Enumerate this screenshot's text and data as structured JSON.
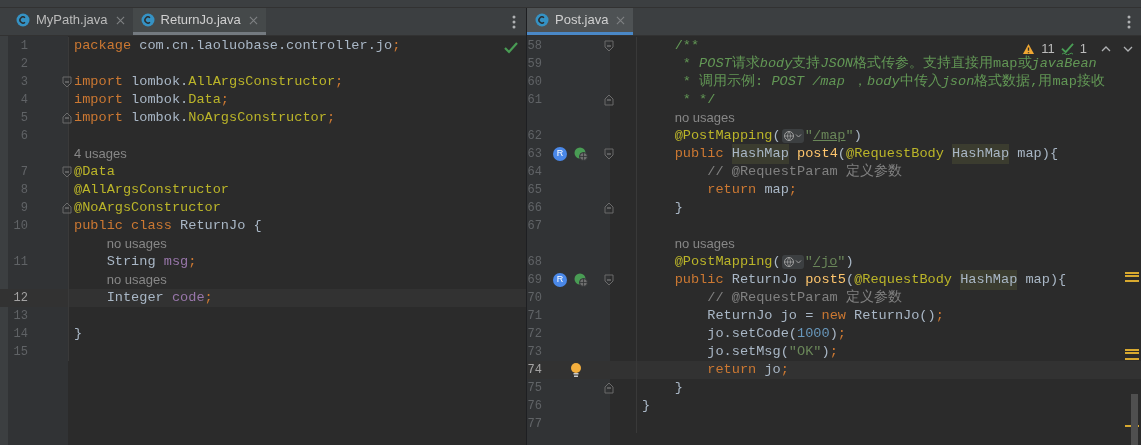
{
  "panes": [
    {
      "focused": false,
      "inspection": {
        "kind": "ok"
      },
      "tabs": [
        {
          "label": "MyPath.java",
          "selected": false
        },
        {
          "label": "ReturnJo.java",
          "selected": true
        }
      ],
      "lines": [
        {
          "num": "1",
          "current": false,
          "fold_open": false,
          "fold_close": false,
          "tokens": [
            {
              "kind": "kw",
              "text": "package "
            },
            {
              "kind": "plain",
              "text": "com.cn.laoluobase.controller.jo"
            },
            {
              "kind": "kw",
              "text": ";"
            }
          ]
        },
        {
          "num": "2",
          "current": false,
          "fold_open": false,
          "fold_close": false
        },
        {
          "num": "3",
          "current": false,
          "fold_open": true,
          "fold_close": false,
          "tokens": [
            {
              "kind": "kw",
              "text": "import "
            },
            {
              "kind": "plain",
              "text": "lombok."
            },
            {
              "kind": "ann",
              "text": "AllArgsConstructor"
            },
            {
              "kind": "kw",
              "text": ";"
            }
          ]
        },
        {
          "num": "4",
          "current": false,
          "fold_open": false,
          "fold_close": false,
          "tokens": [
            {
              "kind": "kw",
              "text": "import "
            },
            {
              "kind": "plain",
              "text": "lombok."
            },
            {
              "kind": "ann",
              "text": "Data"
            },
            {
              "kind": "kw",
              "text": ";"
            }
          ]
        },
        {
          "num": "5",
          "current": false,
          "fold_open": false,
          "fold_close": true,
          "tokens": [
            {
              "kind": "kw",
              "text": "import "
            },
            {
              "kind": "plain",
              "text": "lombok."
            },
            {
              "kind": "ann",
              "text": "NoArgsConstructor"
            },
            {
              "kind": "kw",
              "text": ";"
            }
          ]
        },
        {
          "num": "6",
          "current": false,
          "fold_open": false,
          "fold_close": false
        },
        {
          "hint": "4 usages"
        },
        {
          "num": "7",
          "current": false,
          "fold_open": true,
          "fold_close": false,
          "tokens": [
            {
              "kind": "ann",
              "text": "@Data"
            }
          ]
        },
        {
          "num": "8",
          "current": false,
          "fold_open": false,
          "fold_close": false,
          "tokens": [
            {
              "kind": "ann",
              "text": "@AllArgsConstructor"
            }
          ]
        },
        {
          "num": "9",
          "current": false,
          "fold_open": false,
          "fold_close": true,
          "tokens": [
            {
              "kind": "ann",
              "text": "@NoArgsConstructor"
            }
          ]
        },
        {
          "num": "10",
          "current": false,
          "fold_open": false,
          "fold_close": false,
          "tokens": [
            {
              "kind": "kw",
              "text": "public class "
            },
            {
              "kind": "plain",
              "text": "ReturnJo {"
            }
          ]
        },
        {
          "hint": "no usages"
        },
        {
          "num": "11",
          "current": false,
          "fold_open": false,
          "fold_close": false,
          "tokens": [
            {
              "kind": "plain",
              "text": "    String "
            },
            {
              "kind": "fld",
              "text": "msg"
            },
            {
              "kind": "kw",
              "text": ";"
            }
          ]
        },
        {
          "hint": "no usages"
        },
        {
          "num": "12",
          "current": true,
          "fold_open": false,
          "fold_close": false,
          "tokens": [
            {
              "kind": "plain",
              "text": "    Integer "
            },
            {
              "kind": "fld",
              "text": "code"
            },
            {
              "kind": "kw",
              "text": ";"
            }
          ]
        },
        {
          "num": "13",
          "current": false,
          "fold_open": false,
          "fold_close": false
        },
        {
          "num": "14",
          "current": false,
          "fold_open": false,
          "fold_close": false,
          "tokens": [
            {
              "kind": "plain",
              "text": "}"
            }
          ]
        },
        {
          "num": "15",
          "current": false,
          "fold_open": false,
          "fold_close": false
        }
      ]
    },
    {
      "focused": true,
      "inspection": {
        "kind": "problems",
        "warnings": "11",
        "typos": "1"
      },
      "tabs": [
        {
          "label": "Post.java",
          "selected": true
        }
      ],
      "lines": [
        {
          "num": "58",
          "current": false,
          "fold_open": true,
          "fold_close": false,
          "endpoint": false,
          "bulb": false,
          "tokens": [
            {
              "kind": "doc",
              "text": "    /**"
            }
          ]
        },
        {
          "num": "59",
          "current": false,
          "fold_open": false,
          "fold_close": false,
          "endpoint": false,
          "bulb": false,
          "tokens": [
            {
              "kind": "doc",
              "text": "     * "
            },
            {
              "kind": "doci",
              "text": "POST"
            },
            {
              "kind": "doc",
              "text": "请求"
            },
            {
              "kind": "doci",
              "text": "body"
            },
            {
              "kind": "doc",
              "text": "支持"
            },
            {
              "kind": "doci",
              "text": "JSON"
            },
            {
              "kind": "doc",
              "text": "格式传参。支持直接用map或"
            },
            {
              "kind": "doci",
              "text": "javaBean"
            }
          ]
        },
        {
          "num": "60",
          "current": false,
          "fold_open": false,
          "fold_close": false,
          "endpoint": false,
          "bulb": false,
          "tokens": [
            {
              "kind": "doc",
              "text": "     * 调用示例: "
            },
            {
              "kind": "doci",
              "text": "POST /map"
            },
            {
              "kind": "doc",
              "text": " ，"
            },
            {
              "kind": "doci",
              "text": "body"
            },
            {
              "kind": "doc",
              "text": "中传入"
            },
            {
              "kind": "doci",
              "text": "json"
            },
            {
              "kind": "doc",
              "text": "格式数据,用map接收"
            }
          ]
        },
        {
          "num": "61",
          "current": false,
          "fold_open": false,
          "fold_close": true,
          "endpoint": false,
          "bulb": false,
          "tokens": [
            {
              "kind": "doc",
              "text": "     * */"
            }
          ]
        },
        {
          "hint": "no usages"
        },
        {
          "num": "62",
          "current": false,
          "fold_open": false,
          "fold_close": false,
          "endpoint": false,
          "bulb": false,
          "tokens": [
            {
              "kind": "ann",
              "text": "    @PostMapping"
            },
            {
              "kind": "plain",
              "text": "("
            },
            {
              "kind": "globe"
            },
            {
              "kind": "str",
              "text": "\""
            },
            {
              "kind": "url",
              "text": "/map"
            },
            {
              "kind": "str",
              "text": "\""
            },
            {
              "kind": "plain",
              "text": ")"
            }
          ]
        },
        {
          "num": "63",
          "current": false,
          "fold_open": true,
          "fold_close": false,
          "badge": "R",
          "endpoint": true,
          "bulb": false,
          "tokens": [
            {
              "kind": "kw",
              "text": "    public "
            },
            {
              "kind": "hl",
              "text": "HashMap"
            },
            {
              "kind": "method",
              "text": " post4"
            },
            {
              "kind": "plain",
              "text": "("
            },
            {
              "kind": "ann",
              "text": "@RequestBody "
            },
            {
              "kind": "hl",
              "text": "HashMap"
            },
            {
              "kind": "plain",
              "text": " map){"
            }
          ]
        },
        {
          "num": "64",
          "current": false,
          "fold_open": false,
          "fold_close": false,
          "endpoint": false,
          "bulb": false,
          "tokens": [
            {
              "kind": "comment",
              "text": "        // @RequestParam 定义参数"
            }
          ]
        },
        {
          "num": "65",
          "current": false,
          "fold_open": false,
          "fold_close": false,
          "endpoint": false,
          "bulb": false,
          "tokens": [
            {
              "kind": "kw",
              "text": "        return "
            },
            {
              "kind": "plain",
              "text": "map"
            },
            {
              "kind": "kw",
              "text": ";"
            }
          ]
        },
        {
          "num": "66",
          "current": false,
          "fold_open": false,
          "fold_close": true,
          "endpoint": false,
          "bulb": false,
          "tokens": [
            {
              "kind": "plain",
              "text": "    }"
            }
          ]
        },
        {
          "num": "67",
          "current": false,
          "fold_open": false,
          "fold_close": false,
          "endpoint": false,
          "bulb": false
        },
        {
          "hint": "no usages"
        },
        {
          "num": "68",
          "current": false,
          "fold_open": false,
          "fold_close": false,
          "endpoint": false,
          "bulb": false,
          "tokens": [
            {
              "kind": "ann",
              "text": "    @PostMapping"
            },
            {
              "kind": "plain",
              "text": "("
            },
            {
              "kind": "globe"
            },
            {
              "kind": "str",
              "text": "\""
            },
            {
              "kind": "url",
              "text": "/jo"
            },
            {
              "kind": "str",
              "text": "\""
            },
            {
              "kind": "plain",
              "text": ")"
            }
          ]
        },
        {
          "num": "69",
          "current": false,
          "fold_open": true,
          "fold_close": false,
          "badge": "R",
          "endpoint": true,
          "bulb": false,
          "tokens": [
            {
              "kind": "kw",
              "text": "    public "
            },
            {
              "kind": "plain",
              "text": "ReturnJo"
            },
            {
              "kind": "method",
              "text": " post5"
            },
            {
              "kind": "plain",
              "text": "("
            },
            {
              "kind": "ann",
              "text": "@RequestBody "
            },
            {
              "kind": "hl",
              "text": "HashMap"
            },
            {
              "kind": "plain",
              "text": " map){"
            }
          ]
        },
        {
          "num": "70",
          "current": false,
          "fold_open": false,
          "fold_close": false,
          "endpoint": false,
          "bulb": false,
          "tokens": [
            {
              "kind": "comment",
              "text": "        // @RequestParam 定义参数"
            }
          ]
        },
        {
          "num": "71",
          "current": false,
          "fold_open": false,
          "fold_close": false,
          "endpoint": false,
          "bulb": false,
          "tokens": [
            {
              "kind": "plain",
              "text": "        ReturnJo jo = "
            },
            {
              "kind": "kw",
              "text": "new "
            },
            {
              "kind": "plain",
              "text": "ReturnJo()"
            },
            {
              "kind": "kw",
              "text": ";"
            }
          ]
        },
        {
          "num": "72",
          "current": false,
          "fold_open": false,
          "fold_close": false,
          "endpoint": false,
          "bulb": false,
          "tokens": [
            {
              "kind": "plain",
              "text": "        jo.setCode("
            },
            {
              "kind": "num",
              "text": "1000"
            },
            {
              "kind": "plain",
              "text": ")"
            },
            {
              "kind": "kw",
              "text": ";"
            }
          ]
        },
        {
          "num": "73",
          "current": false,
          "fold_open": false,
          "fold_close": false,
          "endpoint": false,
          "bulb": false,
          "tokens": [
            {
              "kind": "plain",
              "text": "        jo.setMsg("
            },
            {
              "kind": "str",
              "text": "\"OK\""
            },
            {
              "kind": "plain",
              "text": ")"
            },
            {
              "kind": "kw",
              "text": ";"
            }
          ]
        },
        {
          "num": "74",
          "current": true,
          "fold_open": false,
          "fold_close": false,
          "endpoint": false,
          "bulb": true,
          "tokens": [
            {
              "kind": "kw",
              "text": "        return "
            },
            {
              "kind": "plain",
              "text": "jo"
            },
            {
              "kind": "kw",
              "text": ";"
            }
          ]
        },
        {
          "num": "75",
          "current": false,
          "fold_open": false,
          "fold_close": true,
          "endpoint": false,
          "bulb": false,
          "tokens": [
            {
              "kind": "plain",
              "text": "    }"
            }
          ]
        },
        {
          "num": "76",
          "current": false,
          "fold_open": false,
          "fold_close": false,
          "endpoint": false,
          "bulb": false,
          "tokens": [
            {
              "kind": "plain",
              "text": "}"
            }
          ]
        },
        {
          "num": "77",
          "current": false,
          "fold_open": false,
          "fold_close": false,
          "endpoint": false,
          "bulb": false
        }
      ]
    }
  ]
}
